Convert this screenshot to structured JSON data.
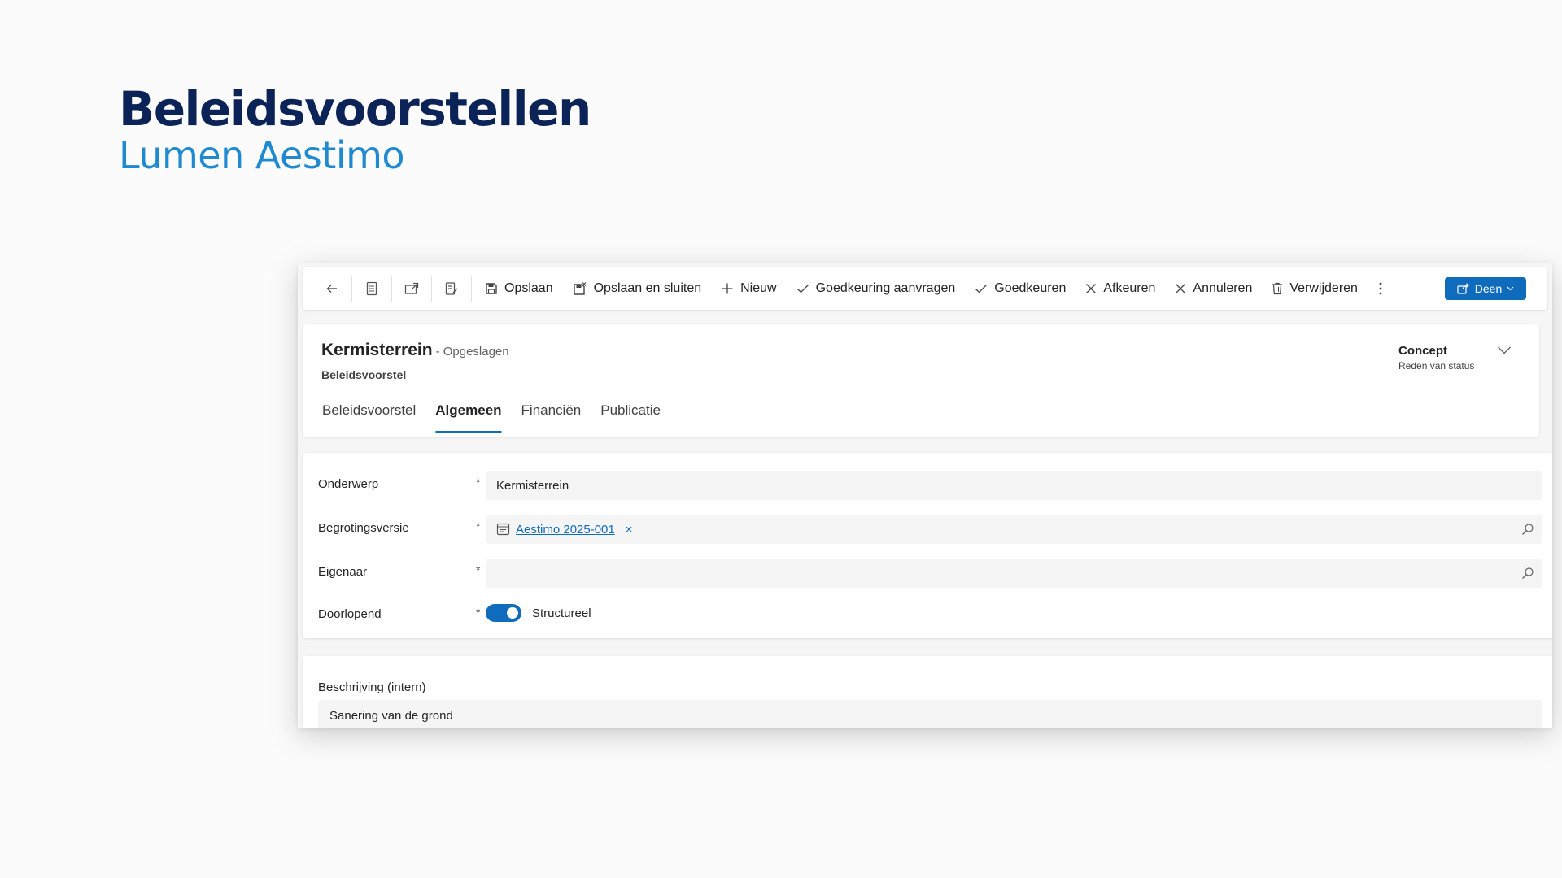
{
  "hero": {
    "title": "Beleidsvoorstellen",
    "subtitle": "Lumen Aestimo",
    "title_color": "#0c2357",
    "subtitle_color": "#1f8ad0"
  },
  "toolbar": {
    "icon_buttons": [
      "back-arrow-icon",
      "form-icon",
      "new-window-icon",
      "edit-note-icon"
    ],
    "save_label": "Opslaan",
    "save_close_label": "Opslaan en sluiten",
    "new_label": "Nieuw",
    "request_approval_label": "Goedkeuring aanvragen",
    "approve_label": "Goedkeuren",
    "reject_label": "Afkeuren",
    "cancel_label": "Annuleren",
    "delete_label": "Verwijderen",
    "more_icon": "more-vertical-icon",
    "share_label": "Deen"
  },
  "header": {
    "record_title": "Kermisterrein",
    "saved_state": "- Opgeslagen",
    "entity_name": "Beleidsvoorstel",
    "status_value": "Concept",
    "status_label": "Reden van status"
  },
  "tabs": [
    {
      "label": "Beleidsvoorstel",
      "active": false
    },
    {
      "label": "Algemeen",
      "active": true
    },
    {
      "label": "Financiën",
      "active": false
    },
    {
      "label": "Publicatie",
      "active": false
    }
  ],
  "form": {
    "subject": {
      "label": "Onderwerp",
      "required": "*",
      "value": "Kermisterrein"
    },
    "budget_version": {
      "label": "Begrotingsversie",
      "required": "*",
      "value": "Aestimo 2025-001",
      "remove": "×"
    },
    "owner": {
      "label": "Eigenaar",
      "required": "*",
      "value": ""
    },
    "ongoing": {
      "label": "Doorlopend",
      "required": "*",
      "toggle_on": true,
      "toggle_label": "Structureel"
    }
  },
  "description": {
    "label": "Beschrijving (intern)",
    "value": "Sanering van de grond"
  },
  "colors": {
    "accent": "#0f6cbd",
    "background": "#fbfbfb"
  }
}
